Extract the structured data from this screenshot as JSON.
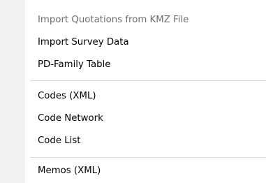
{
  "context_menu": {
    "items": [
      {
        "label": "Import Quotations from KMZ File",
        "enabled": false
      },
      {
        "label": "Import Survey Data",
        "enabled": true
      },
      {
        "label": "PD-Family Table",
        "enabled": true
      },
      {
        "label": "Codes (XML)",
        "enabled": true
      },
      {
        "label": "Code Network",
        "enabled": true
      },
      {
        "label": "Code List",
        "enabled": true
      },
      {
        "label": "Memos (XML)",
        "enabled": true
      }
    ]
  }
}
